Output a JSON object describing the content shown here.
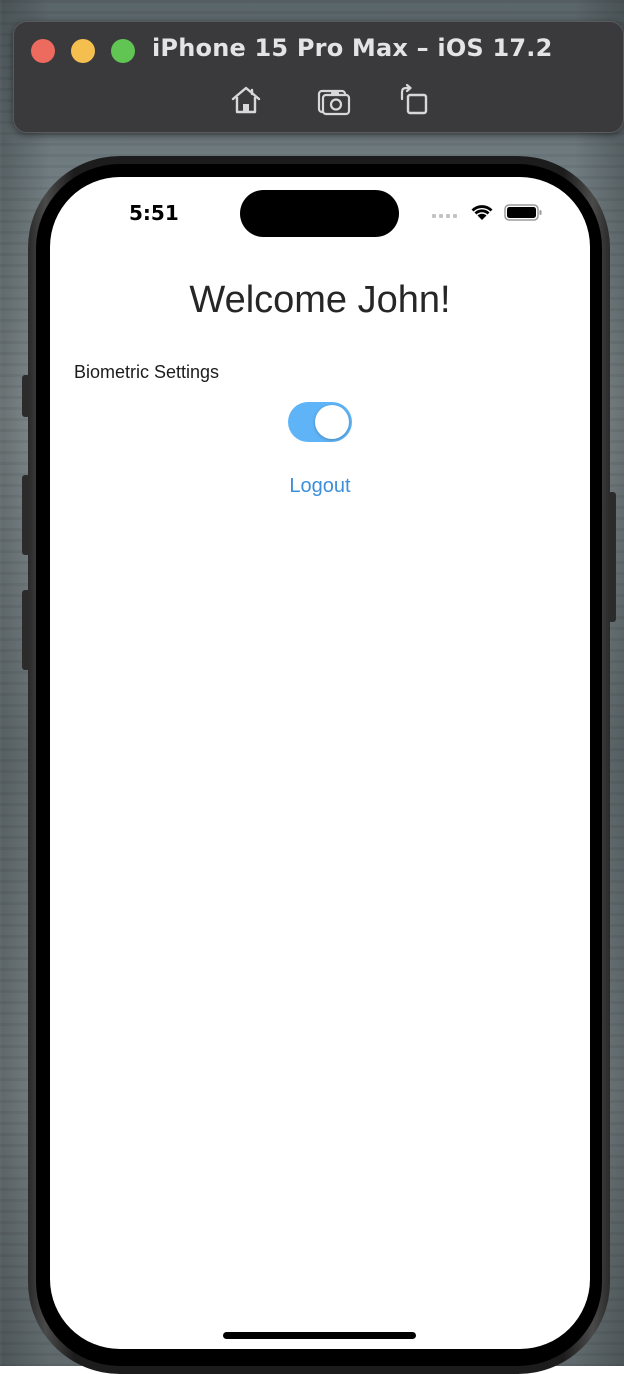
{
  "simulator": {
    "title": "iPhone 15 Pro Max – iOS 17.2",
    "toolbar_icons": [
      "home-icon",
      "screenshot-icon",
      "rotate-icon"
    ]
  },
  "status_bar": {
    "time": "5:51",
    "icons": [
      "cellular-signal-icon",
      "wifi-icon",
      "battery-icon"
    ]
  },
  "screen": {
    "welcome_title": "Welcome John!",
    "biometric_label": "Biometric Settings",
    "biometric_enabled": true,
    "logout_label": "Logout"
  },
  "colors": {
    "toggle_on": "#5fb4f7",
    "link": "#3d8fdb",
    "traffic_red": "#ed6a5e",
    "traffic_yellow": "#f5bf4f",
    "traffic_green": "#61c554"
  }
}
